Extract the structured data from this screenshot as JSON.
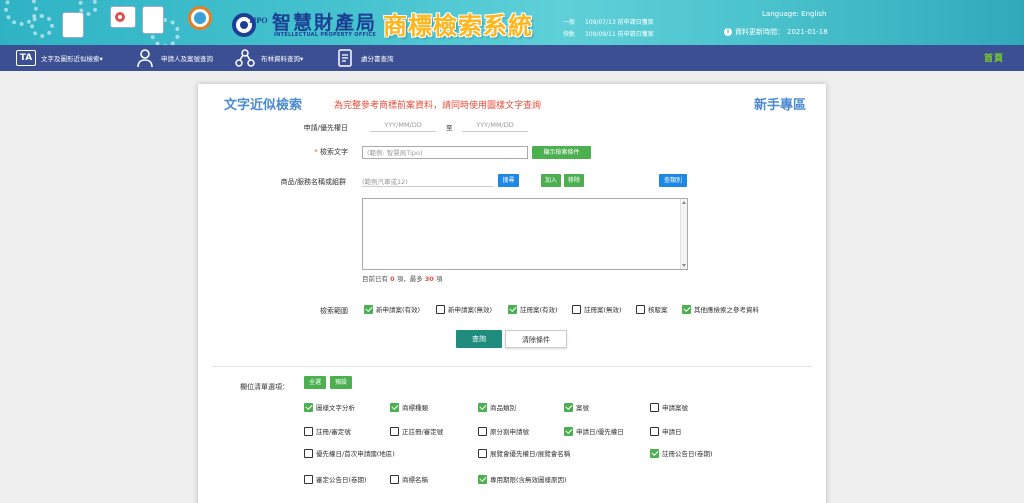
{
  "header": {
    "org_cn": "智慧財產局",
    "org_en": "INTELLECTUAL PROPERTY OFFICE",
    "logo_text": "TIPO",
    "system_title": "商標檢索系統",
    "updates": [
      {
        "label": "一般",
        "text": "109/07/13 前申請日獲案"
      },
      {
        "label": "快軌",
        "text": "109/09/11 前申請日獲案"
      }
    ],
    "language_label": "Language:",
    "language_value": "English",
    "data_update_label": "資料更新時間：",
    "data_update_value": "2021-01-18"
  },
  "nav": {
    "items": [
      {
        "label": "文字及圖形近似檢索▾",
        "icon": "text-image-icon"
      },
      {
        "label": "申請人及案號查詢",
        "icon": "person-icon"
      },
      {
        "label": "布林資料查詢▾",
        "icon": "network-icon"
      },
      {
        "label": "處分書查詢",
        "icon": "document-icon"
      }
    ],
    "right_label": "首頁"
  },
  "form": {
    "title": "文字近似檢索",
    "warning": "為完整參考商標前案資料，請同時使用圖樣文字查詢",
    "newbie": "新手專區",
    "date_label": "申請/優先權日",
    "date_from_placeholder": "YYY/MM/DD",
    "date_to_label": "至",
    "date_to_placeholder": "YYY/MM/DD",
    "search_text_star": "*",
    "search_text_label": "檢索文字",
    "search_text_placeholder": "(範例: 智慧局Tipo)",
    "search_text_button": "顯示檢索條件",
    "goods_label": "商品/服務名稱或組群",
    "goods_placeholder": "(範例汽車或12)",
    "goods_search_button": "搜尋",
    "add_button": "加入",
    "remove_button": "移除",
    "view_class_button": "查類別",
    "count_prefix": "目前已有",
    "count_current": "0",
    "count_mid": "項，最多",
    "count_max": "30",
    "count_suffix": "項",
    "scope_label": "檢索範圍",
    "scope_options": [
      {
        "label": "新申請案(有效)",
        "checked": true
      },
      {
        "label": "新申請案(無效)",
        "checked": false
      },
      {
        "label": "註冊案(有效)",
        "checked": true
      },
      {
        "label": "註冊案(無效)",
        "checked": false
      },
      {
        "label": "核駁案",
        "checked": false
      },
      {
        "label": "其他應檢索之參考資料",
        "checked": true
      }
    ],
    "query_button": "查詢",
    "clear_button": "清除條件"
  },
  "fields": {
    "label": "欄位清單選項：",
    "all_button": "全選",
    "default_button": "預設",
    "rows": [
      [
        {
          "label": "圖樣文字分析",
          "checked": true
        },
        {
          "label": "商標種類",
          "checked": true
        },
        {
          "label": "商品類別",
          "checked": true
        },
        {
          "label": "案號",
          "checked": true
        },
        {
          "label": "申請案號",
          "checked": false
        }
      ],
      [
        {
          "label": "註冊/審定號",
          "checked": false
        },
        {
          "label": "正註冊/審定號",
          "checked": false
        },
        {
          "label": "原分割申請號",
          "checked": false
        },
        {
          "label": "申請日/優先權日",
          "checked": true
        },
        {
          "label": "申請日",
          "checked": false
        }
      ],
      [
        {
          "label": "優先權日/首次申請國(地區)",
          "checked": false
        },
        {
          "label": "展覽會優先權日/展覽會名稱",
          "checked": false
        },
        {
          "label": "註冊公告日(卷期)",
          "checked": true
        }
      ],
      [
        {
          "label": "審定公告日(卷期)",
          "checked": false
        },
        {
          "label": "商標名稱",
          "checked": false
        },
        {
          "label": "專用期限(含無效圖樣原因)",
          "checked": true
        }
      ]
    ]
  },
  "colors": {
    "nav_bg": "#3c4f93",
    "title_blue": "#4a8ad0",
    "warn_red": "#e74c3c",
    "check_green": "#4caf50",
    "query_teal": "#1f8c7d",
    "title_orange": "#ffb51c"
  }
}
